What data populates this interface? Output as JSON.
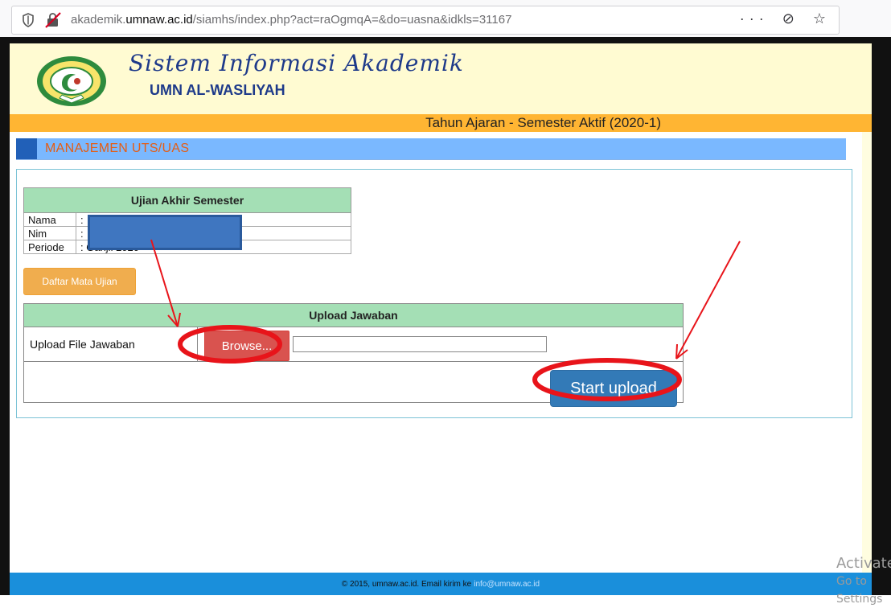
{
  "browser": {
    "url_prefix": "akademik.",
    "url_host": "umnaw.ac.id",
    "url_rest": "/siamhs/index.php?act=raOgmqA=&do=uasna&idkls=31167",
    "actions": [
      "···",
      "⊘",
      "☆"
    ]
  },
  "header": {
    "title": "Sistem Informasi Akademik",
    "subtitle": "UMN AL-WASLIYAH",
    "semester": "Tahun Ajaran - Semester Aktif (2020-1)"
  },
  "section": {
    "title": "MANAJEMEN UTS/UAS"
  },
  "exam": {
    "heading": "Ujian Akhir Semester",
    "rows": [
      {
        "label": "Nama",
        "value": ":"
      },
      {
        "label": "Nim",
        "value": ":"
      },
      {
        "label": "Periode",
        "value": ": Ganjil 2020"
      }
    ],
    "daftar_button": "Daftar Mata Ujian"
  },
  "upload": {
    "heading": "Upload Jawaban",
    "row_label": "Upload File Jawaban",
    "browse_button": "Browse...",
    "start_button": "Start upload"
  },
  "footer": {
    "text": "© 2015, umnaw.ac.id. Email kirim ke",
    "email": "info@umnaw.ac.id"
  },
  "watermark": {
    "line1": "Activate",
    "line2": "Go to Settings"
  },
  "colors": {
    "semester_bar": "#ffb533",
    "section_bar": "#7ab8ff",
    "table_head": "#a4dfb5",
    "browse": "#d9534f",
    "start": "#337ab7",
    "daftar": "#f0ad4e",
    "annotation": "#e8141a"
  }
}
